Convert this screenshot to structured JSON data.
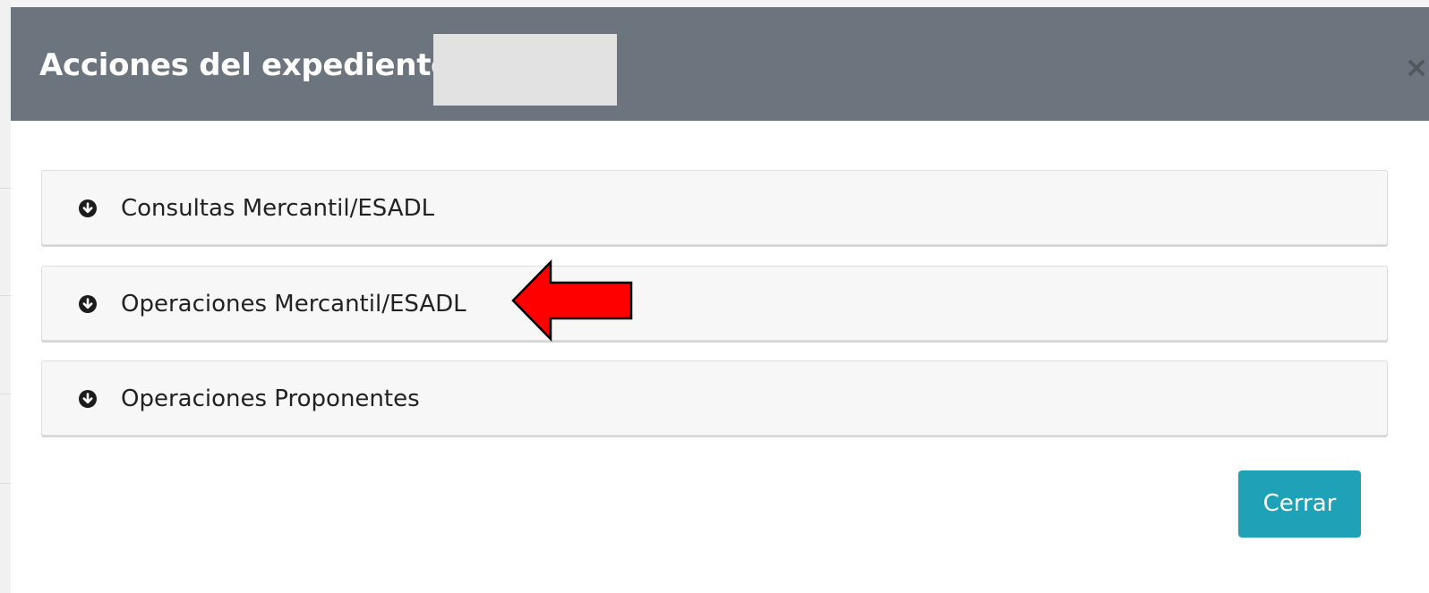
{
  "modal": {
    "title": "Acciones del expediente",
    "close_icon": "×"
  },
  "accordion": {
    "items": [
      {
        "label": "Consultas Mercantil/ESADL",
        "icon": "circle-arrow-down-icon"
      },
      {
        "label": "Operaciones Mercantil/ESADL",
        "icon": "circle-arrow-down-icon"
      },
      {
        "label": "Operaciones Proponentes",
        "icon": "circle-arrow-down-icon"
      }
    ]
  },
  "annotation": {
    "type": "red-arrow",
    "color": "#ff0000",
    "points_to": "Operaciones Mercantil/ESADL"
  },
  "footer": {
    "close_label": "Cerrar"
  },
  "colors": {
    "header_bg": "#6c757d",
    "accordion_bg": "#f7f7f7",
    "primary_button": "#1fa2b8",
    "redaction": "#e2e2e2"
  }
}
